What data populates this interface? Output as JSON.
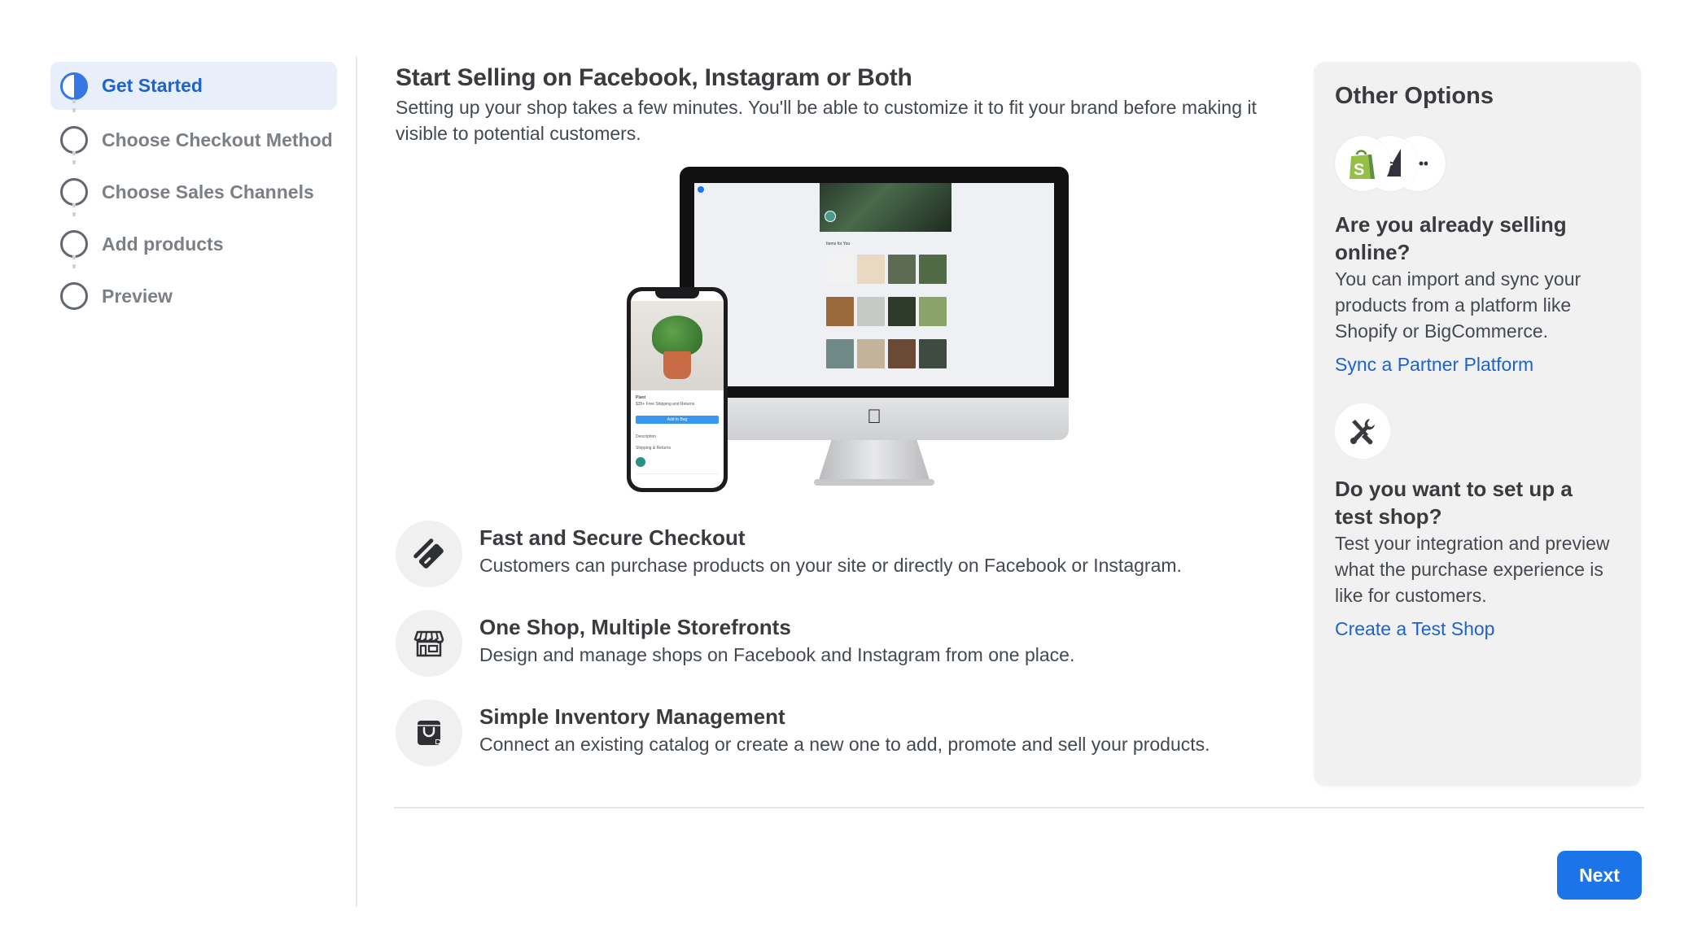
{
  "sidebar": {
    "steps": [
      {
        "label": "Get Started",
        "state": "in-progress"
      },
      {
        "label": "Choose Checkout Method",
        "state": "not-started"
      },
      {
        "label": "Choose Sales Channels",
        "state": "not-started"
      },
      {
        "label": "Add products",
        "state": "not-started"
      },
      {
        "label": "Preview",
        "state": "not-started"
      }
    ]
  },
  "main": {
    "title": "Start Selling on Facebook, Instagram or Both",
    "subtitle": "Setting up your shop takes a few minutes. You'll be able to customize it to fit your brand before making it visible to potential customers.",
    "illustration": {
      "phone_product_name": "Plant",
      "phone_shipping": "$35+ Free Shipping and Returns",
      "phone_button": "Add to Bag",
      "phone_rows": [
        "Description",
        "Shipping & Returns"
      ],
      "monitor_section": "Items for You"
    },
    "features": [
      {
        "icon": "credit-card-icon",
        "title": "Fast and Secure Checkout",
        "description": "Customers can purchase products on your site or directly on Facebook or Instagram."
      },
      {
        "icon": "storefront-icon",
        "title": "One Shop, Multiple Storefronts",
        "description": "Design and manage shops on Facebook and Instagram from one place."
      },
      {
        "icon": "shopping-bag-icon",
        "title": "Simple Inventory Management",
        "description": "Connect an existing catalog or create a new one to add, promote and sell your products."
      }
    ],
    "next_label": "Next"
  },
  "options": {
    "title": "Other Options",
    "partner_logos": [
      "shopify-logo",
      "bigcommerce-logo",
      "more-partners-logo"
    ],
    "sections": [
      {
        "question": "Are you already selling online?",
        "description": "You can import and sync your products from a platform like Shopify or BigCommerce.",
        "link": "Sync a Partner Platform"
      },
      {
        "question": "Do you want to set up a test shop?",
        "description": "Test your integration and preview what the purchase experience is like for customers.",
        "link": "Create a Test Shop"
      }
    ]
  },
  "colors": {
    "accent": "#1b74e8",
    "active_step_bg": "#e8effb",
    "active_step_text": "#1d63c9",
    "link": "#1d63c9",
    "panel_bg": "#f1f1f2",
    "text": "#444950",
    "shopify_green": "#95bf47",
    "bigcommerce_dark": "#34313f"
  }
}
